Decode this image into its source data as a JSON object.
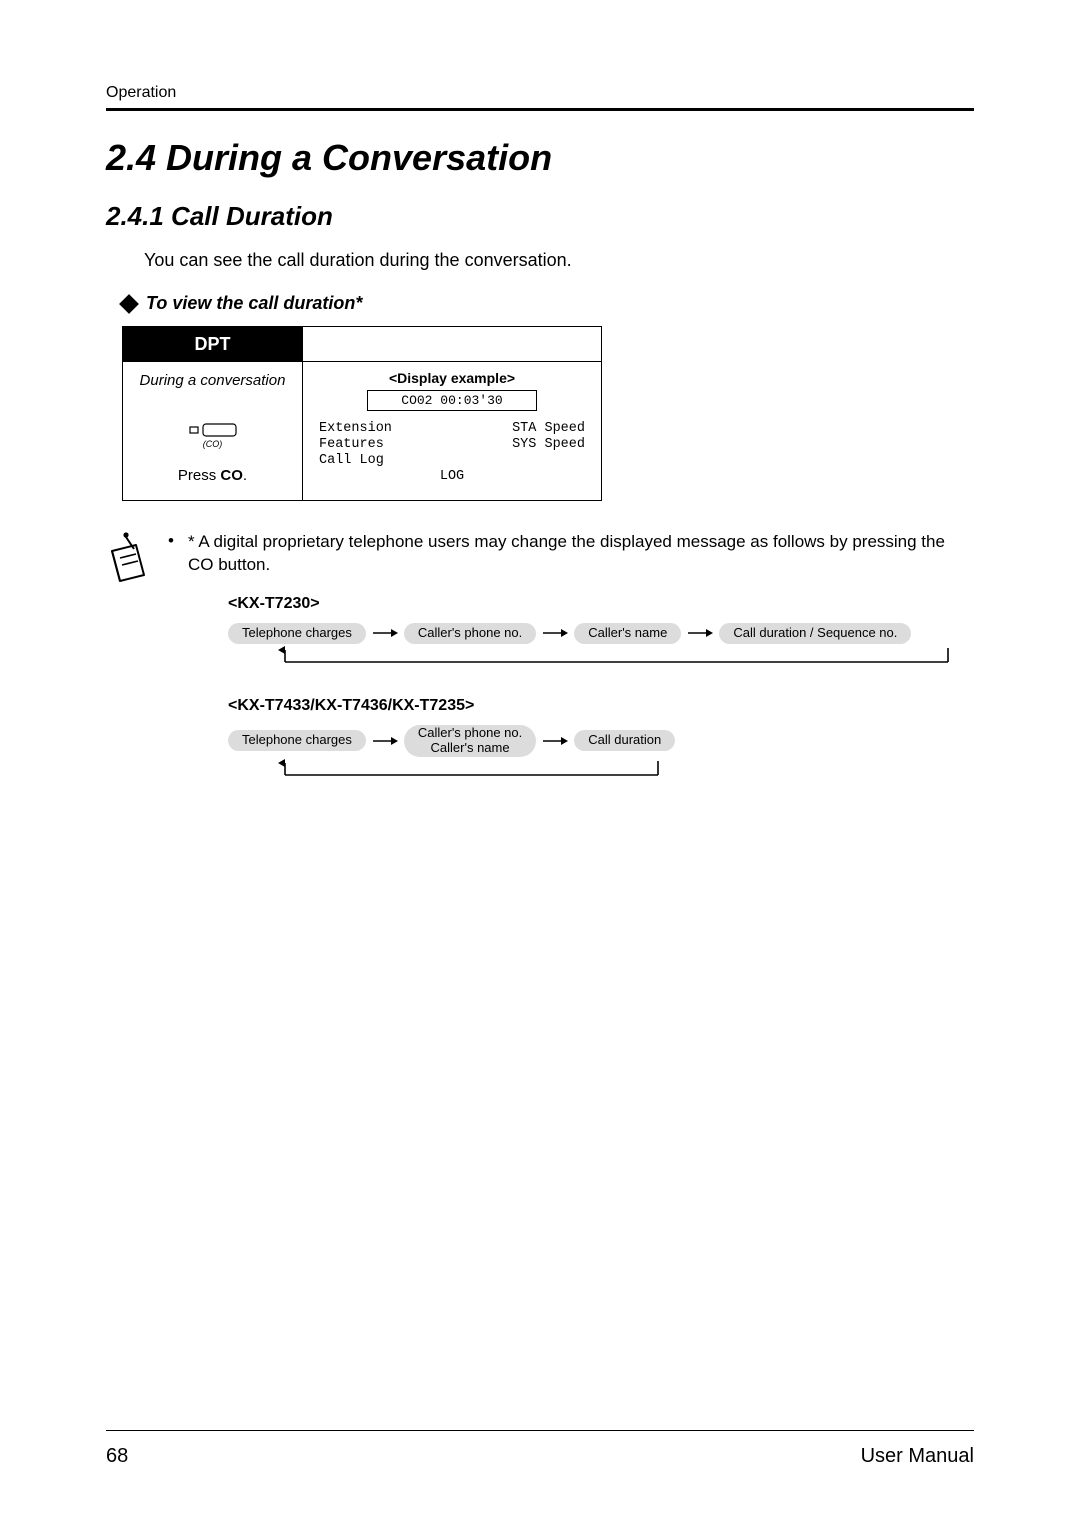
{
  "header": {
    "running": "Operation"
  },
  "headings": {
    "section": "2.4   During a Conversation",
    "subsection": "2.4.1   Call Duration"
  },
  "intro": "You can see the call duration during the conversation.",
  "view_title": "To view the call duration*",
  "dpt": {
    "tab": "DPT",
    "left_title": "During a conversation",
    "co_label": "(CO)",
    "press_prefix": "Press ",
    "press_key": "CO",
    "press_suffix": ".",
    "disp_title": "<Display example>",
    "lcd": "CO02 00:03'30",
    "rows": {
      "r1l": "Extension",
      "r1r": "STA Speed",
      "r2l": "Features",
      "r2r": "SYS Speed",
      "r3l": "Call Log",
      "r3r": "",
      "log": "LOG"
    }
  },
  "note": {
    "bullet": "•",
    "text": "* A digital proprietary telephone users may change the displayed message as follows by pressing the CO button."
  },
  "flows": {
    "model1": "<KX-T7230>",
    "model2": "<KX-T7433/KX-T7436/KX-T7235>",
    "f1": {
      "a": "Telephone charges",
      "b": "Caller's phone no.",
      "c": "Caller's name",
      "d": "Call duration / Sequence no."
    },
    "f2": {
      "a": "Telephone charges",
      "b1": "Caller's phone no.",
      "b2": "Caller's name",
      "c": "Call duration"
    }
  },
  "footer": {
    "page": "68",
    "label": "User Manual"
  }
}
